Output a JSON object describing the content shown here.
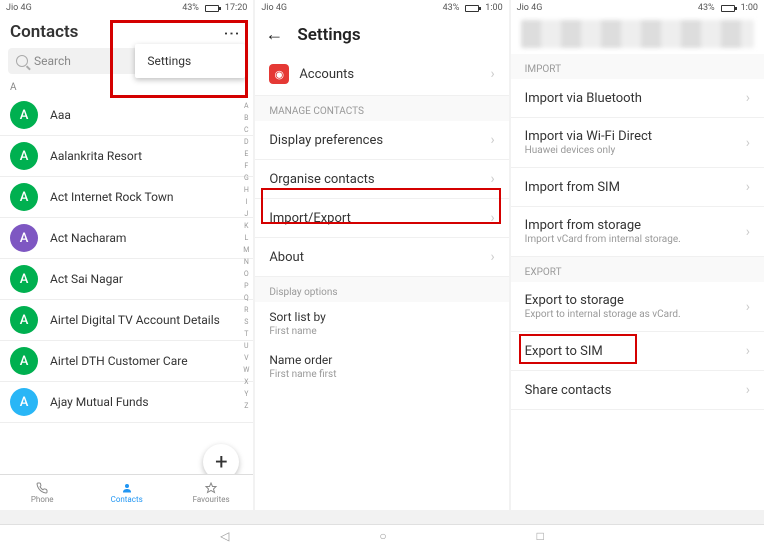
{
  "statusbar": {
    "carrier": "Jio 4G",
    "battery": "43%",
    "time": "1:00",
    "time_partial": "17:20"
  },
  "panel1": {
    "title": "Contacts",
    "search_placeholder": "Search",
    "menu_item": "Settings",
    "section_letter": "A",
    "contacts": [
      {
        "initial": "A",
        "name": "Aaa",
        "color": "av-green"
      },
      {
        "initial": "A",
        "name": "Aalankrita Resort",
        "color": "av-green"
      },
      {
        "initial": "A",
        "name": "Act Internet Rock Town",
        "color": "av-green"
      },
      {
        "initial": "A",
        "name": "Act Nacharam",
        "color": "av-purple"
      },
      {
        "initial": "A",
        "name": "Act Sai Nagar",
        "color": "av-green"
      },
      {
        "initial": "A",
        "name": "Airtel Digital TV Account Details",
        "color": "av-green"
      },
      {
        "initial": "A",
        "name": "Airtel DTH Customer Care",
        "color": "av-green"
      },
      {
        "initial": "A",
        "name": "Ajay Mutual Funds",
        "color": "av-blue"
      }
    ],
    "az_index": "A B C D E F G H I J K L M N O P Q R S T U V W X Y Z",
    "nav": {
      "phone": "Phone",
      "contacts": "Contacts",
      "favourites": "Favourites"
    }
  },
  "panel2": {
    "title": "Settings",
    "accounts": "Accounts",
    "section_manage": "MANAGE CONTACTS",
    "rows_manage": [
      "Display preferences",
      "Organise contacts",
      "Import/Export",
      "About"
    ],
    "section_display": "Display options",
    "sort_label": "Sort list by",
    "sort_value": "First name",
    "name_label": "Name order",
    "name_value": "First name first"
  },
  "panel3": {
    "section_import": "IMPORT",
    "import_rows": [
      {
        "title": "Import via Bluetooth",
        "sub": ""
      },
      {
        "title": "Import via Wi-Fi Direct",
        "sub": "Huawei devices only"
      },
      {
        "title": "Import from SIM",
        "sub": ""
      },
      {
        "title": "Import from storage",
        "sub": "Import vCard from internal storage."
      }
    ],
    "section_export": "EXPORT",
    "export_rows": [
      {
        "title": "Export to storage",
        "sub": "Export to internal storage as vCard."
      },
      {
        "title": "Export to SIM",
        "sub": ""
      },
      {
        "title": "Share contacts",
        "sub": ""
      }
    ]
  }
}
